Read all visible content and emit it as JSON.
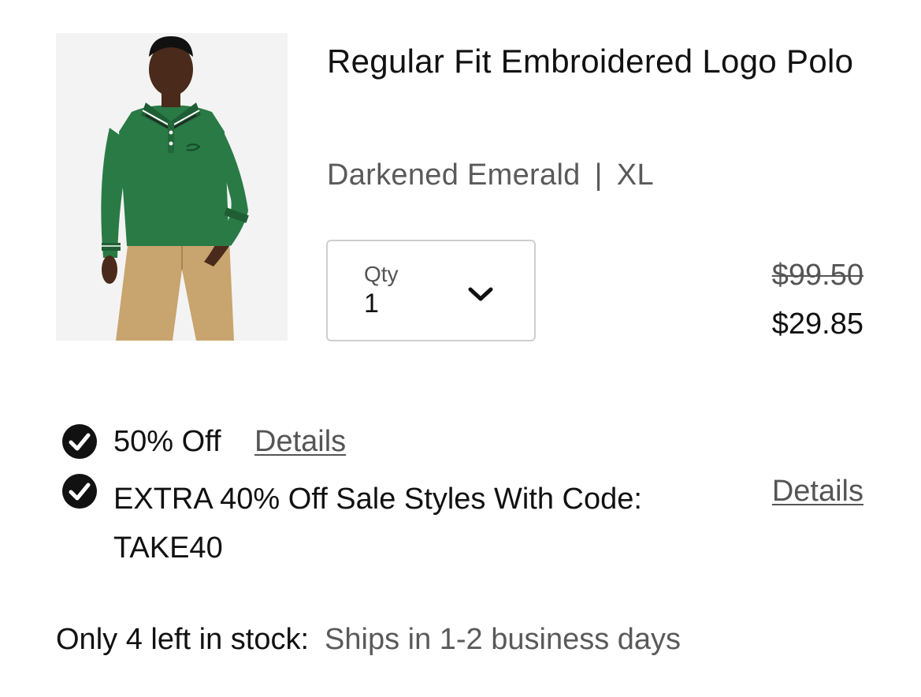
{
  "product": {
    "title": "Regular Fit Embroidered Logo Polo",
    "color": "Darkened Emerald",
    "separator": "|",
    "size": "XL",
    "image_alt": "Model wearing green long-sleeve polo and khaki pants"
  },
  "quantity": {
    "label": "Qty",
    "value": "1"
  },
  "price": {
    "original": "$99.50",
    "sale": "$29.85"
  },
  "promotions": [
    {
      "text": "50% Off",
      "link": "Details",
      "icon": "checkmark-circle-icon"
    },
    {
      "text": "EXTRA 40% Off Sale Styles With Code: TAKE40",
      "link": "Details",
      "icon": "checkmark-circle-icon"
    }
  ],
  "stock": {
    "label": "Only 4 left in stock:",
    "shipping": "Ships in 1-2 business days"
  },
  "colors": {
    "shirt": "#2a7a45",
    "pants": "#c8a46e",
    "text": "#111111",
    "muted": "#5a5a5a",
    "border": "#cfcfcf"
  }
}
